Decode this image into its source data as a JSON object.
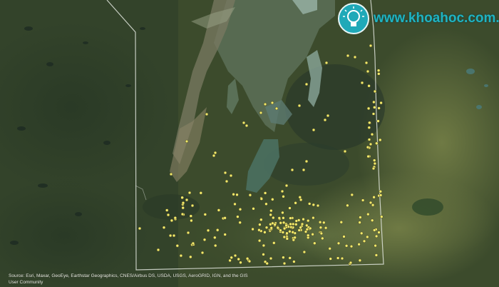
{
  "map": {
    "basemap": "satellite imagery",
    "boundary_color": "#dfe4dc",
    "marker_color": "#f2ea6a",
    "marker_outline": "#3a3a20"
  },
  "attribution": {
    "line1": "Source: Esri, Maxar, GeoEye, Earthstar Geographics, CNES/Airbus DS, USDA, USGS, AeroGRID, IGN, and the GIS",
    "line2": "User Community"
  },
  "watermark": {
    "text": "www.khoahoc.com.vn",
    "icon": "lightbulb-icon",
    "color": "#1fb3c1"
  }
}
